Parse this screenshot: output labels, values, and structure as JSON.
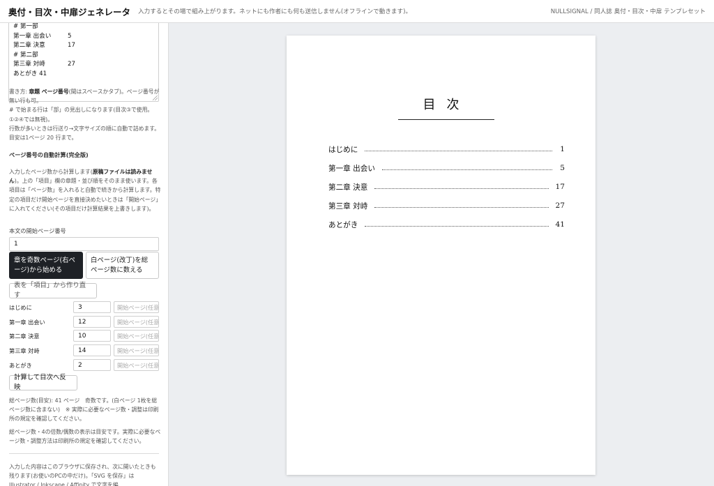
{
  "header": {
    "title": "奥付・目次・中扉ジェネレータ",
    "subtitle": "入力するとその場で組み上がります。ネットにも作者にも何も送信しません(オフラインで動きます)。",
    "brand": "NULLSIGNAL / 同人誌 奥付・目次・中扉 テンプレセット"
  },
  "sidebar": {
    "textarea_lines": [
      {
        "title": "# 第一部",
        "page": ""
      },
      {
        "title": "第一章 出会い",
        "page": "5"
      },
      {
        "title": "第二章 決意",
        "page": "17"
      },
      {
        "title": "# 第二部",
        "page": ""
      },
      {
        "title": "第三章 対峙",
        "page": "27"
      },
      {
        "title": "あとがき 41",
        "page": ""
      }
    ],
    "help1_pre": "書き方: ",
    "help1_bold": "章題 ページ番号",
    "help1_post": "(間はスペースかタブ)。ページ番号が無い行も可。",
    "help2": "# で始まる行は「部」の見出しになります(目次③で使用。①②④では無視)。",
    "help3": "行数が多いときは行送り→文字サイズの順に自動で詰めます。目安は1ページ 20 行まで。",
    "auto_title": "ページ番号の自動計算(完全版)",
    "auto_help_pre": "入力したページ数から計算します(",
    "auto_help_bold": "原稿ファイルは読みません",
    "auto_help_post": ")。上の「項目」欄の章題・並び順をそのまま使います。各項目は「ページ数」を入れると自動で続きから計算します。特定の項目だけ開始ページを直接決めたいときは「開始ページ」に入れてください(その項目だけ計算結果を上書きします)。",
    "start_label": "本文の開始ページ番号",
    "start_value": "1",
    "btn_odd": "章を奇数ページ(右ページ)から始める",
    "btn_blank": "白ページ(改丁)を総ページ数に数える",
    "btn_rebuild": "表を「項目」から作り直す",
    "rows": [
      {
        "label": "はじめに",
        "pages": "3",
        "start_placeholder": "開始ページ(任意)"
      },
      {
        "label": "第一章 出会い",
        "pages": "12",
        "start_placeholder": "開始ページ(任意)"
      },
      {
        "label": "第二章 決意",
        "pages": "10",
        "start_placeholder": "開始ページ(任意)"
      },
      {
        "label": "第三章 対峙",
        "pages": "14",
        "start_placeholder": "開始ページ(任意)"
      },
      {
        "label": "あとがき",
        "pages": "2",
        "start_placeholder": "開始ページ(任意)"
      }
    ],
    "btn_calc": "計算して目次へ反映",
    "total_text": "総ページ数(目安): 41 ページ　奇数です。(白ページ 1枚を総ページ数に含まない)　※ 実際に必要なページ数・調整は印刷所の規定を確認してください。",
    "note_text": "総ページ数・4の倍数/偶数の表示は目安です。実際に必要なページ数・調整方法は印刷所の規定を確認してください。",
    "storage_text": "入力した内容はこのブラウザに保存され、次に開いたときも残ります(お使いのPCの中だけ)。「SVG を保存」は Illustrator / Inkscape / Affinity で文字を編"
  },
  "preview": {
    "title": "目次",
    "entries": [
      {
        "title": "はじめに",
        "page": "1"
      },
      {
        "title": "第一章 出会い",
        "page": "5"
      },
      {
        "title": "第二章 決意",
        "page": "17"
      },
      {
        "title": "第三章 対峙",
        "page": "27"
      },
      {
        "title": "あとがき",
        "page": "41"
      }
    ]
  }
}
